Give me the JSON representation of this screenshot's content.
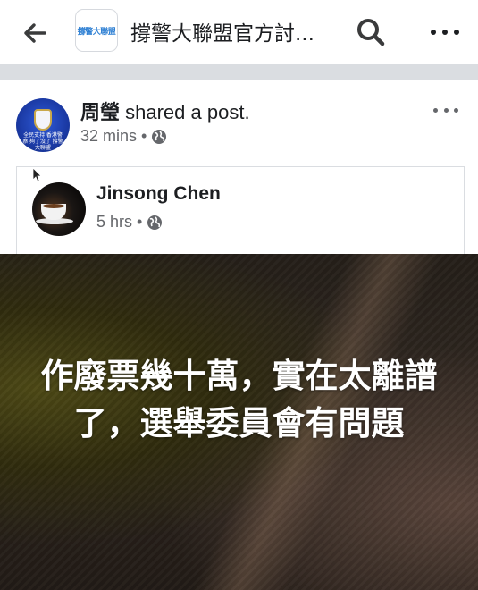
{
  "topbar": {
    "group_thumb_text": "撐警大聯盟",
    "group_title": "撐警大聯盟官方討...",
    "back_icon": "arrow-left-icon",
    "search_icon": "search-icon",
    "more_icon": "more-horizontal-icon"
  },
  "post": {
    "author_name": "周瑩",
    "action_text": " shared a post.",
    "time": "32 mins",
    "separator": "•",
    "privacy_icon": "globe-icon",
    "avatar_text": "全民支持 香港警察 夠了沒了 撐警大聯盟"
  },
  "shared": {
    "author_name": "Jinsong Chen",
    "time": "5 hrs",
    "separator": "•",
    "privacy_icon": "globe-icon"
  },
  "photo": {
    "caption": "作廢票幾十萬，實在太離譜了，選舉委員會有問題"
  },
  "colors": {
    "text_primary": "#1c1e21",
    "text_secondary": "#65676b",
    "divider": "#dadde1",
    "caption": "#ffffff"
  }
}
